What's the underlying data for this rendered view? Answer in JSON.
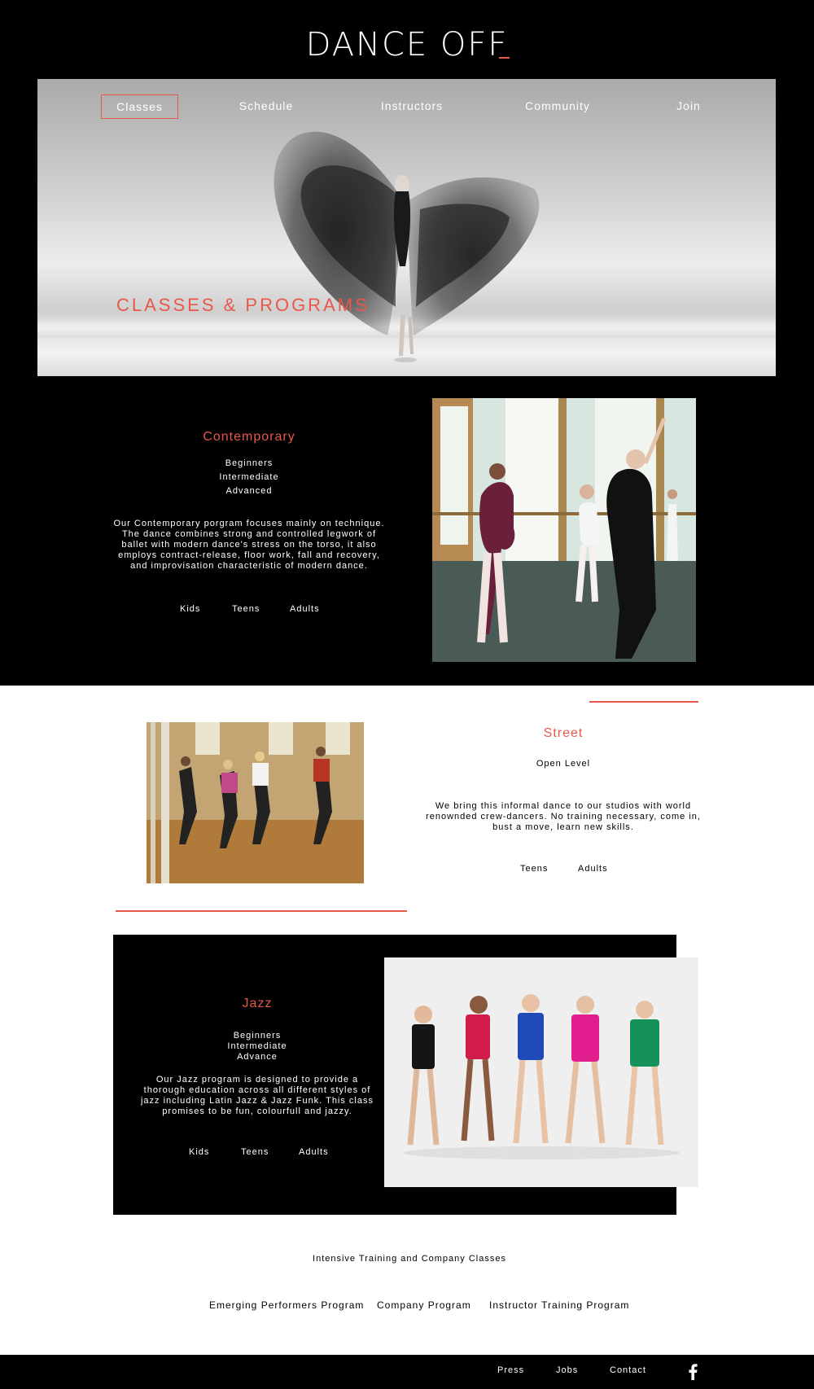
{
  "brand": {
    "logo_main": "DANCE OF",
    "logo_accent": "F",
    "accent_color": "#e8584a"
  },
  "nav": {
    "items": [
      {
        "label": "Classes",
        "active": true
      },
      {
        "label": "Schedule",
        "active": false
      },
      {
        "label": "Instructors",
        "active": false
      },
      {
        "label": "Community",
        "active": false
      },
      {
        "label": "Join",
        "active": false
      }
    ]
  },
  "hero": {
    "title": "CLASSES & PROGRAMS",
    "image": "dancer-in-flowing-dark-fabric"
  },
  "contemporary": {
    "title": "Contemporary",
    "levels": [
      "Beginners",
      "Intermediate",
      "Advanced"
    ],
    "description": [
      "Our Contemporary porgram focuses mainly on technique.",
      "The dance combines strong and controlled legwork of",
      "ballet with modern dance's stress on the torso, it also",
      "employs contract-release, floor work, fall and recovery,",
      "and improvisation characteristic of modern dance."
    ],
    "ages": [
      "Kids",
      "Teens",
      "Adults"
    ],
    "image": "ballet-class-at-barre"
  },
  "street": {
    "title": "Street",
    "levels": [
      "Open Level"
    ],
    "description": [
      "We bring this informal dance to our studios with world",
      "renownded crew-dancers. No training necessary, come in,",
      "bust a move, learn new skills."
    ],
    "ages": [
      "Teens",
      "Adults"
    ],
    "image": "group-street-dance-class"
  },
  "jazz": {
    "title": "Jazz",
    "levels": [
      "Beginners",
      "Intermediate",
      "Advance"
    ],
    "description": [
      "Our Jazz program is designed to provide a",
      "thorough education across all different styles of",
      "jazz including Latin Jazz & Jazz Funk. This class",
      "promises to be fun, colourfull and jazzy."
    ],
    "ages": [
      "Kids",
      "Teens",
      "Adults"
    ],
    "image": "young-jazz-dancers-in-costumes"
  },
  "intensive": {
    "heading": "Intensive Training and Company Classes",
    "programs": [
      "Emerging Performers Program",
      "Company Program",
      "Instructor Training Program"
    ]
  },
  "footer": {
    "links": [
      "Press",
      "Jobs",
      "Contact"
    ],
    "social_icon": "facebook-icon"
  }
}
